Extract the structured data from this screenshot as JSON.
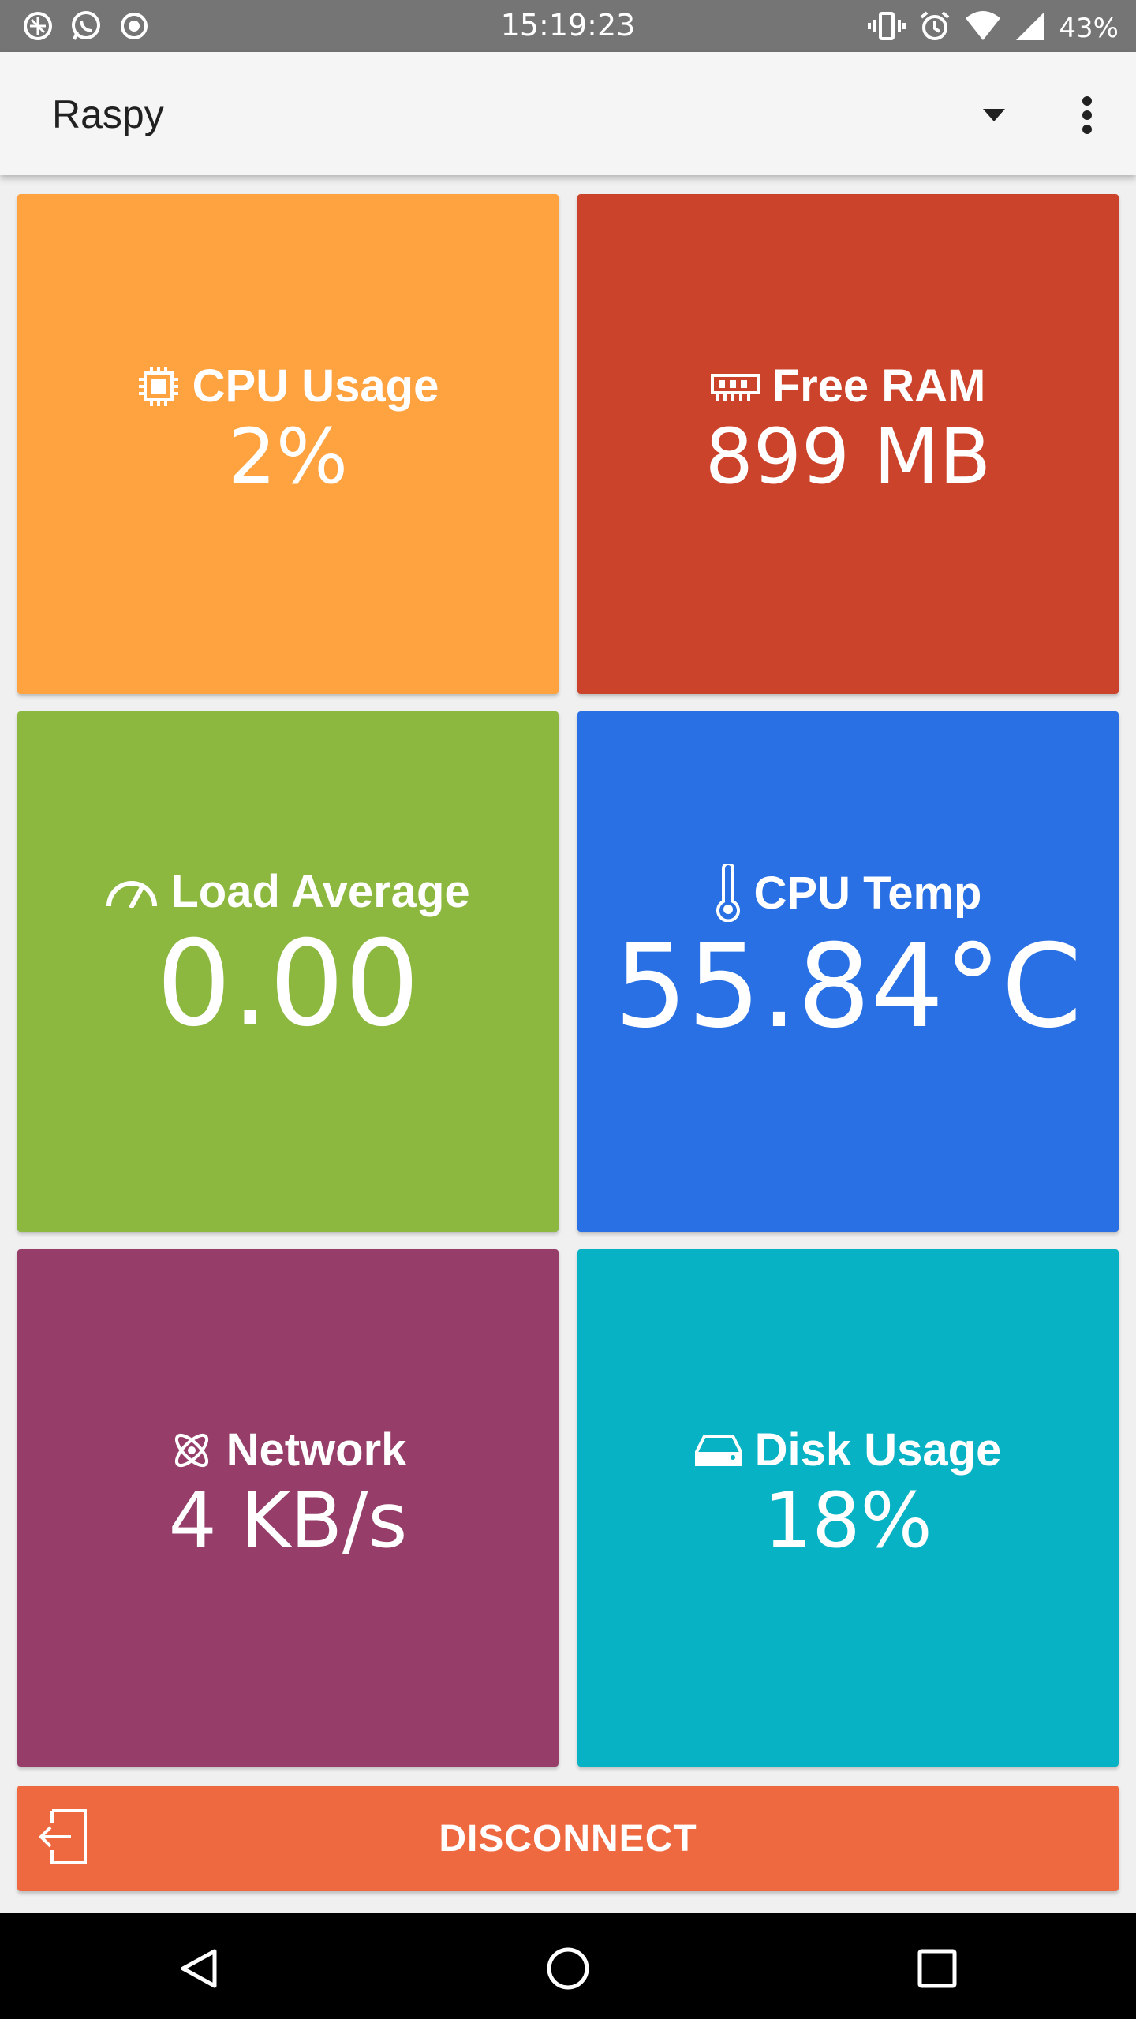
{
  "status_bar": {
    "time": "15:19:23",
    "battery": "43%",
    "icons_left": [
      "browser-icon",
      "whatsapp-icon",
      "record-icon"
    ],
    "icons_right": [
      "vibrate-icon",
      "alarm-icon",
      "wifi-icon",
      "signal-icon"
    ]
  },
  "app_bar": {
    "title": "Raspy",
    "dropdown_icon": "caret-down-icon",
    "menu_icon": "more-vert-icon"
  },
  "tiles": [
    {
      "title": "CPU Usage",
      "value": "2%",
      "icon": "cpu-chip-icon",
      "color": "#ffa240"
    },
    {
      "title": "Free RAM",
      "value": "899 MB",
      "icon": "memory-icon",
      "color": "#cc432b"
    },
    {
      "title": "Load Average",
      "value": "0.00",
      "icon": "speedometer-icon",
      "color": "#8db840"
    },
    {
      "title": "CPU Temp",
      "value": "55.84°C",
      "icon": "thermometer-icon",
      "color": "#2870e3"
    },
    {
      "title": "Network",
      "value": "4 KB/s",
      "icon": "atom-icon",
      "color": "#963e69"
    },
    {
      "title": "Disk Usage",
      "value": "18%",
      "icon": "harddisk-icon",
      "color": "#06b2c4"
    }
  ],
  "disconnect": {
    "label": "DISCONNECT",
    "icon": "logout-icon",
    "color": "#ee693f"
  },
  "nav_bar": {
    "buttons": [
      "back-icon",
      "home-icon",
      "recents-icon"
    ]
  }
}
